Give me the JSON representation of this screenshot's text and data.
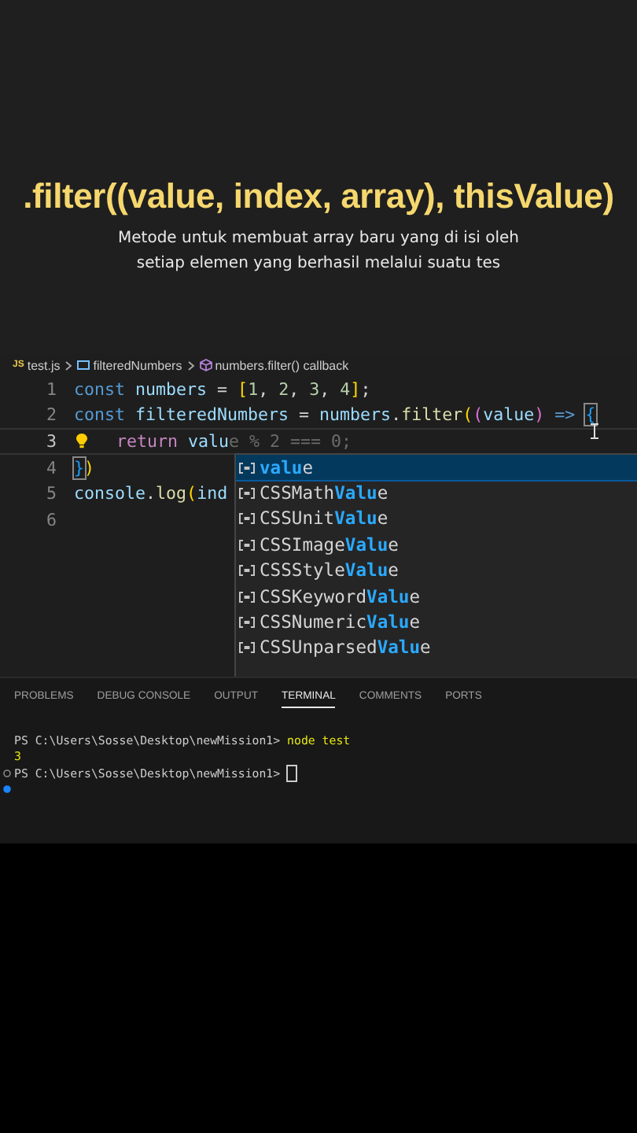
{
  "title": ".filter((value, index, array), thisValue)",
  "subtitle": [
    "Metode untuk membuat array baru yang di isi oleh",
    "setiap elemen yang berhasil melalui suatu tes"
  ],
  "breadcrumbs": [
    {
      "text": "test.js",
      "kind": "file",
      "icon_text": "JS"
    },
    {
      "text": "filteredNumbers",
      "kind": "variable"
    },
    {
      "text": "numbers.filter() callback",
      "kind": "method"
    }
  ],
  "code_lines": [
    {
      "number": "1",
      "current": false,
      "lightbulb": false,
      "tokens": [
        {
          "text": "const",
          "kind": "keyword"
        },
        {
          "text": " numbers",
          "kind": "variable"
        },
        {
          "text": " = ",
          "kind": "plain"
        },
        {
          "text": "[",
          "kind": "bracket1"
        },
        {
          "text": "1",
          "kind": "number"
        },
        {
          "text": ", ",
          "kind": "plain"
        },
        {
          "text": "2",
          "kind": "number"
        },
        {
          "text": ", ",
          "kind": "plain"
        },
        {
          "text": "3",
          "kind": "number"
        },
        {
          "text": ", ",
          "kind": "plain"
        },
        {
          "text": "4",
          "kind": "number"
        },
        {
          "text": "]",
          "kind": "bracket1"
        },
        {
          "text": ";",
          "kind": "plain"
        }
      ]
    },
    {
      "number": "2",
      "current": false,
      "lightbulb": false,
      "tokens": [
        {
          "text": "const",
          "kind": "keyword"
        },
        {
          "text": " filteredNumbers",
          "kind": "variable"
        },
        {
          "text": " = ",
          "kind": "plain"
        },
        {
          "text": "numbers",
          "kind": "variable"
        },
        {
          "text": ".",
          "kind": "plain"
        },
        {
          "text": "filter",
          "kind": "function"
        },
        {
          "text": "(",
          "kind": "bracket1"
        },
        {
          "text": "(",
          "kind": "bracket2"
        },
        {
          "text": "value",
          "kind": "variable"
        },
        {
          "text": ")",
          "kind": "bracket2"
        },
        {
          "text": " => ",
          "kind": "keyword"
        },
        {
          "text": "{",
          "kind": "bracket3-match"
        }
      ]
    },
    {
      "number": "3",
      "current": true,
      "lightbulb": true,
      "tokens": [
        {
          "text": "  return",
          "kind": "control"
        },
        {
          "text": " valu",
          "kind": "variable"
        },
        {
          "text": "e % 2 === 0;",
          "kind": "ghost"
        }
      ]
    },
    {
      "number": "4",
      "current": false,
      "lightbulb": false,
      "tokens": [
        {
          "text": "}",
          "kind": "bracket3-match"
        },
        {
          "text": ")",
          "kind": "bracket1"
        }
      ]
    },
    {
      "number": "5",
      "current": false,
      "lightbulb": false,
      "tokens": [
        {
          "text": "console",
          "kind": "variable"
        },
        {
          "text": ".",
          "kind": "plain"
        },
        {
          "text": "log",
          "kind": "function"
        },
        {
          "text": "(",
          "kind": "bracket1"
        },
        {
          "text": "ind",
          "kind": "variable"
        }
      ]
    },
    {
      "number": "6",
      "current": false,
      "lightbulb": false
    }
  ],
  "suggestions": [
    {
      "match": "valu",
      "suffix": "e",
      "selected": true
    },
    {
      "prefix": "CSSMath",
      "match": "Valu",
      "suffix": "e",
      "selected": false
    },
    {
      "prefix": "CSSUnit",
      "match": "Valu",
      "suffix": "e",
      "selected": false
    },
    {
      "prefix": "CSSImage",
      "match": "Valu",
      "suffix": "e",
      "selected": false
    },
    {
      "prefix": "CSSStyle",
      "match": "Valu",
      "suffix": "e",
      "selected": false
    },
    {
      "prefix": "CSSKeyword",
      "match": "Valu",
      "suffix": "e",
      "selected": false
    },
    {
      "prefix": "CSSNumeric",
      "match": "Valu",
      "suffix": "e",
      "selected": false
    },
    {
      "prefix": "CSSUnparsed",
      "match": "Valu",
      "suffix": "e",
      "selected": false
    }
  ],
  "panel_tabs": [
    {
      "label": "PROBLEMS",
      "selected": false
    },
    {
      "label": "DEBUG CONSOLE",
      "selected": false
    },
    {
      "label": "OUTPUT",
      "selected": false
    },
    {
      "label": "TERMINAL",
      "selected": true
    },
    {
      "label": "COMMENTS",
      "selected": false
    },
    {
      "label": "PORTS",
      "selected": false
    }
  ],
  "terminal": [
    {
      "kind": "command",
      "finished": false,
      "running": false,
      "prompt": "PS C:\\Users\\Sosse\\Desktop\\newMission1>",
      "text": "node test"
    },
    {
      "kind": "output",
      "finished": false,
      "running": false,
      "text": "3"
    },
    {
      "kind": "command",
      "finished": true,
      "running": false,
      "prompt": "PS C:\\Users\\Sosse\\Desktop\\newMission1>",
      "cursor": true
    },
    {
      "kind": "empty",
      "finished": false,
      "running": true
    }
  ]
}
